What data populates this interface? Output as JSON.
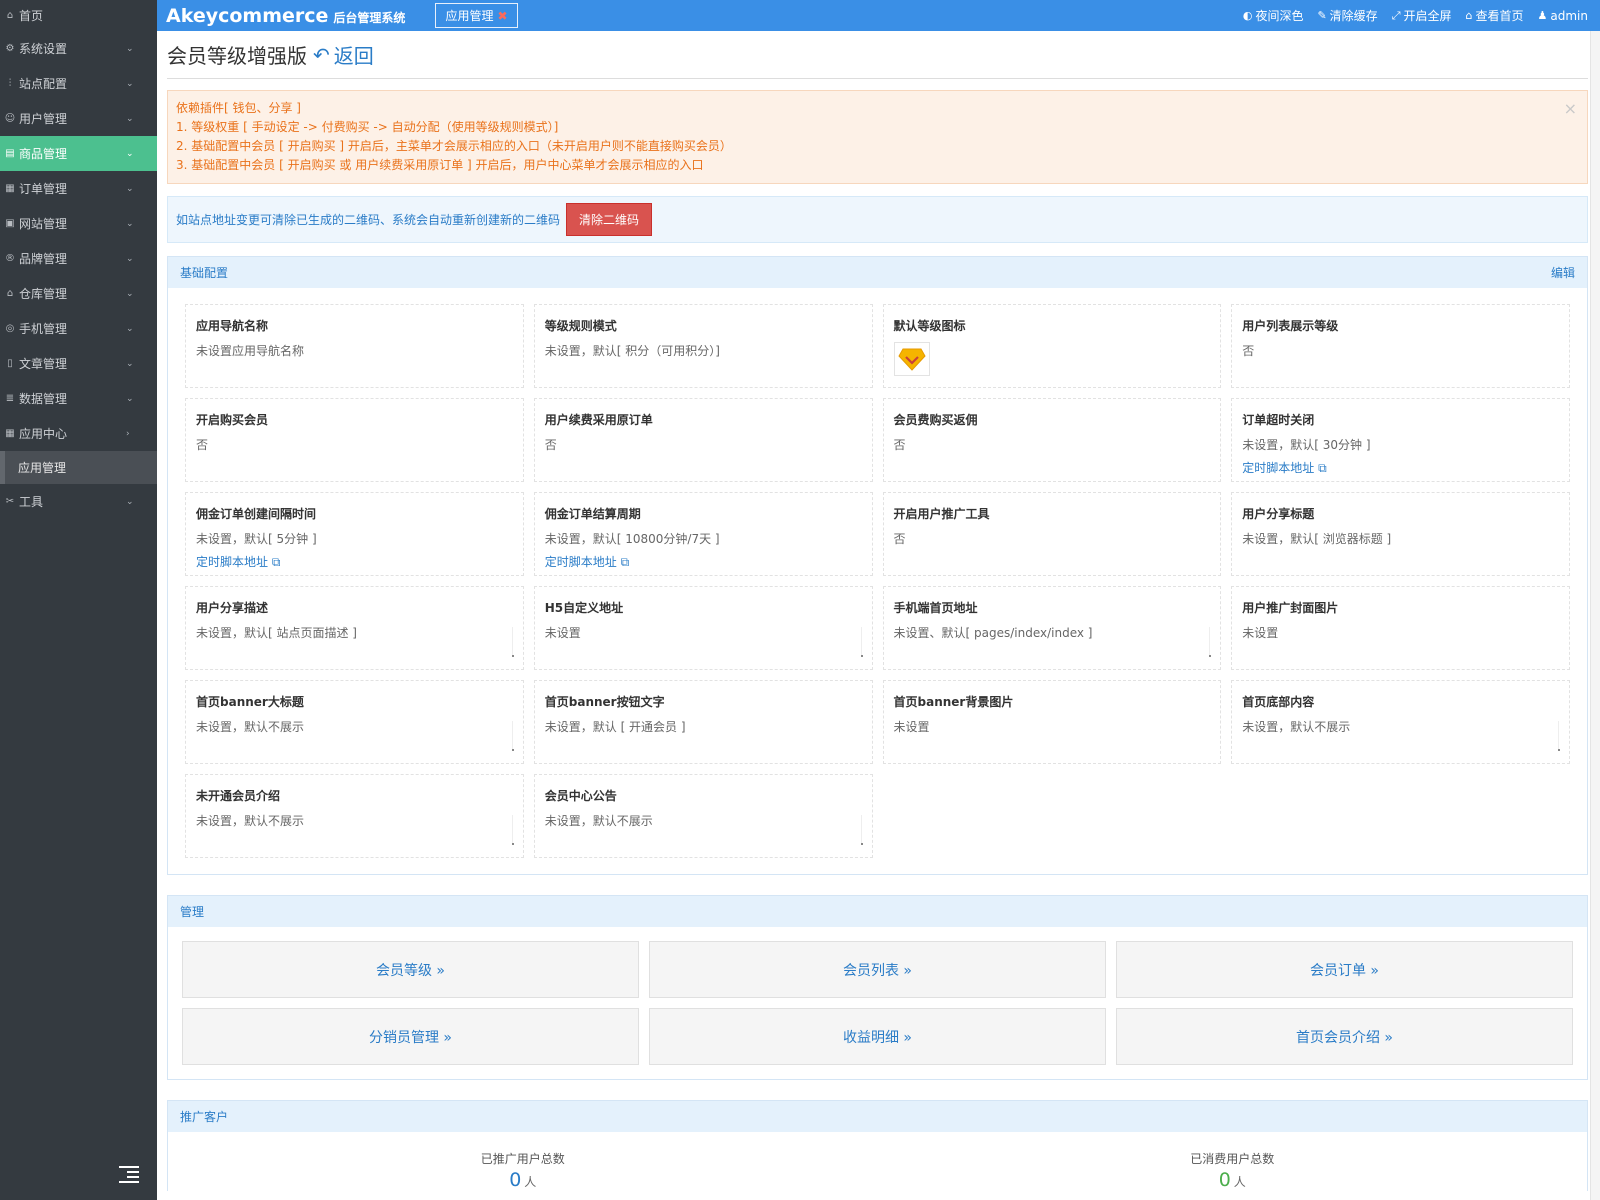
{
  "sidebar": {
    "items": [
      {
        "label": "首页",
        "icon": "home-icon",
        "glyph": "⌂"
      },
      {
        "label": "系统设置",
        "icon": "gear-icon",
        "glyph": "⚙"
      },
      {
        "label": "站点配置",
        "icon": "sliders-icon",
        "glyph": "⫶"
      },
      {
        "label": "用户管理",
        "icon": "user-icon",
        "glyph": "☺"
      },
      {
        "label": "商品管理",
        "icon": "goods-icon",
        "glyph": "▤"
      },
      {
        "label": "订单管理",
        "icon": "order-icon",
        "glyph": "▦"
      },
      {
        "label": "网站管理",
        "icon": "website-icon",
        "glyph": "▣"
      },
      {
        "label": "品牌管理",
        "icon": "brand-icon",
        "glyph": "®"
      },
      {
        "label": "仓库管理",
        "icon": "warehouse-icon",
        "glyph": "⌂"
      },
      {
        "label": "手机管理",
        "icon": "mobile-icon",
        "glyph": "◎"
      },
      {
        "label": "文章管理",
        "icon": "article-icon",
        "glyph": "▯"
      },
      {
        "label": "数据管理",
        "icon": "database-icon",
        "glyph": "≣"
      },
      {
        "label": "应用中心",
        "icon": "apps-icon",
        "glyph": "▦"
      },
      {
        "label": "应用管理",
        "icon": "",
        "glyph": ""
      },
      {
        "label": "工具",
        "icon": "tools-icon",
        "glyph": "✂"
      }
    ]
  },
  "header": {
    "brand": "Akeycommerce",
    "brand_sub": "后台管理系统",
    "tab": "应用管理",
    "actions": [
      {
        "label": "夜间深色",
        "icon": "contrast-icon",
        "glyph": "◐"
      },
      {
        "label": "清除缓存",
        "icon": "brush-icon",
        "glyph": "✎"
      },
      {
        "label": "开启全屏",
        "icon": "fullscreen-icon",
        "glyph": "⤢"
      },
      {
        "label": "查看首页",
        "icon": "home-icon",
        "glyph": "⌂"
      },
      {
        "label": "admin",
        "icon": "user-icon",
        "glyph": "♟"
      }
    ]
  },
  "page": {
    "title": "会员等级增强版",
    "back": "返回"
  },
  "alert": {
    "lines": [
      "依赖插件[ 钱包、分享 ]",
      "1. 等级权重 [ 手动设定 -> 付费购买 -> 自动分配（使用等级规则模式）]",
      "2. 基础配置中会员 [ 开启购买 ] 开启后，主菜单才会展示相应的入口（未开启用户则不能直接购买会员）",
      "3. 基础配置中会员 [ 开启购买 或 用户续费采用原订单 ] 开启后，用户中心菜单才会展示相应的入口"
    ]
  },
  "info": {
    "text": "如站点地址变更可清除已生成的二维码、系统会自动重新创建新的二维码",
    "button": "清除二维码"
  },
  "base_panel": {
    "title": "基础配置",
    "edit": "编辑",
    "cells": [
      {
        "label": "应用导航名称",
        "value": "未设置应用导航名称"
      },
      {
        "label": "等级规则模式",
        "value": "未设置，默认[ 积分（可用积分）]"
      },
      {
        "label": "默认等级图标",
        "value": ""
      },
      {
        "label": "用户列表展示等级",
        "value": "否"
      },
      {
        "label": "开启购买会员",
        "value": "否"
      },
      {
        "label": "用户续费采用原订单",
        "value": "否"
      },
      {
        "label": "会员费购买返佣",
        "value": "否"
      },
      {
        "label": "订单超时关闭",
        "value": "未设置，默认[ 30分钟 ]",
        "link": "定时脚本地址"
      },
      {
        "label": "佣金订单创建间隔时间",
        "value": "未设置，默认[ 5分钟 ]",
        "link": "定时脚本地址"
      },
      {
        "label": "佣金订单结算周期",
        "value": "未设置，默认[ 10800分钟/7天 ]",
        "link": "定时脚本地址"
      },
      {
        "label": "开启用户推广工具",
        "value": "否"
      },
      {
        "label": "用户分享标题",
        "value": "未设置，默认[ 浏览器标题 ]"
      },
      {
        "label": "用户分享描述",
        "value": "未设置，默认[ 站点页面描述 ]"
      },
      {
        "label": "H5自定义地址",
        "value": "未设置"
      },
      {
        "label": "手机端首页地址",
        "value": "未设置、默认[ pages/index/index ]"
      },
      {
        "label": "用户推广封面图片",
        "value": "未设置"
      },
      {
        "label": "首页banner大标题",
        "value": "未设置，默认不展示"
      },
      {
        "label": "首页banner按钮文字",
        "value": "未设置，默认 [ 开通会员 ]"
      },
      {
        "label": "首页banner背景图片",
        "value": "未设置"
      },
      {
        "label": "首页底部内容",
        "value": "未设置，默认不展示"
      },
      {
        "label": "未开通会员介绍",
        "value": "未设置，默认不展示"
      },
      {
        "label": "会员中心公告",
        "value": "未设置，默认不展示"
      }
    ]
  },
  "manage_panel": {
    "title": "管理",
    "buttons": [
      "会员等级 »",
      "会员列表 »",
      "会员订单 »",
      "分销员管理 »",
      "收益明细 »",
      "首页会员介绍 »"
    ]
  },
  "promo_panel": {
    "title": "推广客户",
    "stats": [
      {
        "label": "已推广用户总数",
        "value": "0",
        "unit": "人"
      },
      {
        "label": "已消费用户总数",
        "value": "0",
        "unit": "人"
      }
    ]
  },
  "colors": {
    "header": "#3a8fe6",
    "sidebar": "#343a40",
    "active": "#4cc08f",
    "link": "#2a7cc7",
    "danger": "#d9534f"
  }
}
